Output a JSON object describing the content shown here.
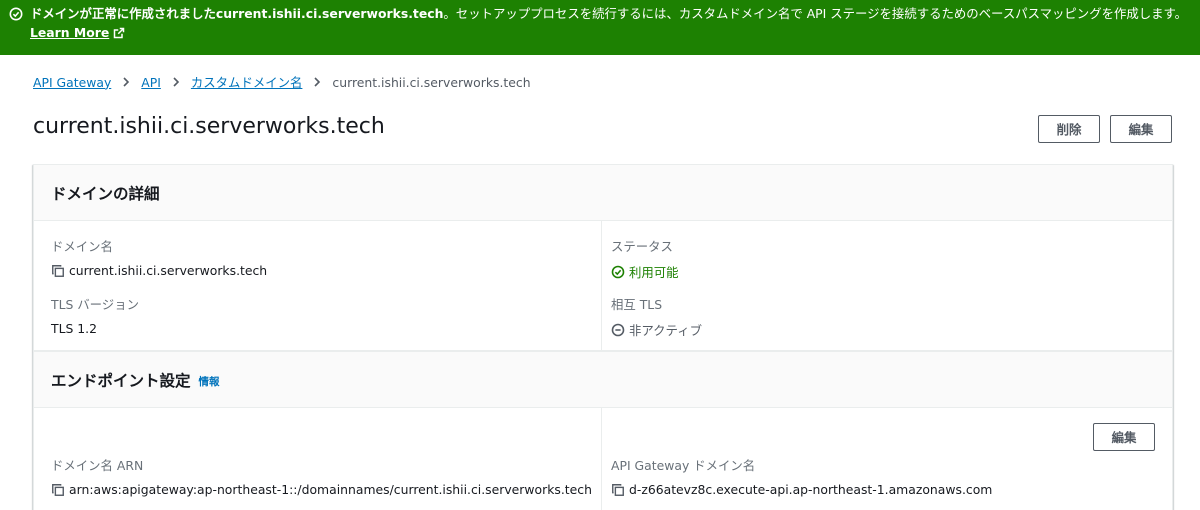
{
  "flash": {
    "message_bold": "ドメインが正常に作成されましたcurrent.ishii.ci.serverworks.tech",
    "message_rest": "。セットアッププロセスを続行するには、カスタムドメイン名で API ステージを接続するためのベースパスマッピングを作成します。",
    "learn_more": "Learn More",
    "color": "#1d8102"
  },
  "breadcrumb": [
    "API Gateway",
    "API",
    "カスタムドメイン名",
    "current.ishii.ci.serverworks.tech"
  ],
  "page": {
    "title": "current.ishii.ci.serverworks.tech",
    "delete_label": "削除",
    "edit_label": "編集"
  },
  "domain_details": {
    "heading": "ドメインの詳細",
    "domain_name_label": "ドメイン名",
    "domain_name_value": "current.ishii.ci.serverworks.tech",
    "status_label": "ステータス",
    "status_value": "利用可能",
    "tls_label": "TLS バージョン",
    "tls_value": "TLS 1.2",
    "mtls_label": "相互 TLS",
    "mtls_value": "非アクティブ"
  },
  "endpoint": {
    "heading": "エンドポイント設定",
    "info_label": "情報",
    "edit_label": "編集",
    "arn_label": "ドメイン名 ARN",
    "arn_value": "arn:aws:apigateway:ap-northeast-1::/domainnames/current.ishii.ci.serverworks.tech",
    "apigw_label": "API Gateway ドメイン名",
    "apigw_value": "d-z66atevz8c.execute-api.ap-northeast-1.amazonaws.com"
  },
  "icons": {
    "flash": "check-circle-icon",
    "external": "external-link-icon",
    "separator": "chevron-right-icon",
    "copy": "copy-icon",
    "status_ok": "status-success-icon",
    "status_inactive": "status-stopped-icon"
  },
  "colors": {
    "link": "#0073bb",
    "success": "#1d8102",
    "muted": "#687078"
  }
}
